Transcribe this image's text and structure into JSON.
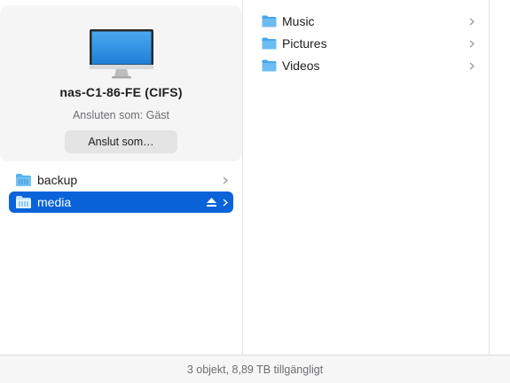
{
  "server": {
    "name": "nas-C1-86-FE (CIFS)",
    "status": "Ansluten som: Gäst",
    "connect_button": "Anslut som…",
    "icon": "monitor-icon"
  },
  "shares": [
    {
      "label": "backup",
      "icon": "share-folder-icon",
      "selected": false
    },
    {
      "label": "media",
      "icon": "share-folder-icon",
      "selected": true,
      "eject_icon": "eject-icon"
    }
  ],
  "items": [
    {
      "label": "Music",
      "icon": "folder-icon"
    },
    {
      "label": "Pictures",
      "icon": "folder-icon"
    },
    {
      "label": "Videos",
      "icon": "folder-icon"
    }
  ],
  "status_bar": {
    "text": "3 objekt, 8,89 TB tillgängligt"
  },
  "colors": {
    "selection": "#0a63d8",
    "folder": "#57b3ee",
    "card_bg": "#f5f5f5"
  }
}
